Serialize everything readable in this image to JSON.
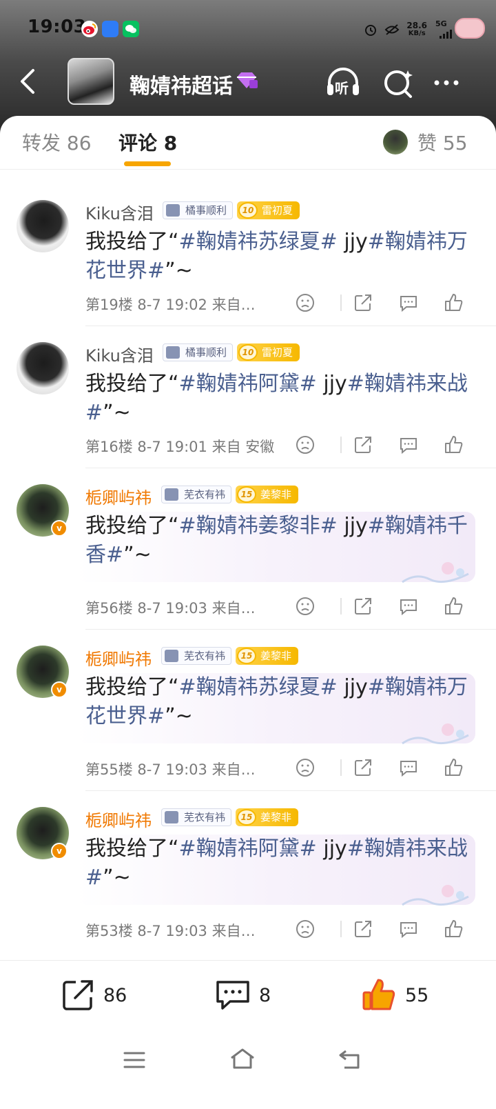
{
  "status_bar": {
    "time": "19:03",
    "net_speed_value": "28.6",
    "net_speed_unit": "KB/s",
    "signal": "5G"
  },
  "header": {
    "title": "鞠婧祎超话",
    "listen_label": "听"
  },
  "tabs": {
    "repost": "转发 86",
    "comment": "评论 8",
    "like": "赞 55"
  },
  "comments": [
    {
      "user": "Kiku含泪",
      "tag": "橘事顺利",
      "level": "10",
      "fan_tag": "雷初夏",
      "text_prefix": "我投给了“",
      "topic1": "#鞠婧祎苏绿夏#",
      "mid": " jjy",
      "topic2": "#鞠婧祎万花世界#",
      "suffix": "”~",
      "meta": "第19楼 8-7 19:02 来自…"
    },
    {
      "user": "Kiku含泪",
      "tag": "橘事顺利",
      "level": "10",
      "fan_tag": "雷初夏",
      "text_prefix": "我投给了“",
      "topic1": "#鞠婧祎阿黛#",
      "mid": " jjy",
      "topic2": "#鞠婧祎来战#",
      "suffix": "”~",
      "meta": "第16楼 8-7 19:01 来自 安徽"
    },
    {
      "user": "栀卿屿祎",
      "tag": "芜衣有祎",
      "level": "15",
      "fan_tag": "姜黎非",
      "text_prefix": "我投给了“",
      "topic1": "#鞠婧祎姜黎非#",
      "mid": " jjy",
      "topic2": "#鞠婧祎千香#",
      "suffix": "”~",
      "meta": "第56楼 8-7 19:03 来自…"
    },
    {
      "user": "栀卿屿祎",
      "tag": "芜衣有祎",
      "level": "15",
      "fan_tag": "姜黎非",
      "text_prefix": "我投给了“",
      "topic1": "#鞠婧祎苏绿夏#",
      "mid": " jjy",
      "topic2": "#鞠婧祎万花世界#",
      "suffix": "”~",
      "meta": "第55楼 8-7 19:03 来自…"
    },
    {
      "user": "栀卿屿祎",
      "tag": "芜衣有祎",
      "level": "15",
      "fan_tag": "姜黎非",
      "text_prefix": "我投给了“",
      "topic1": "#鞠婧祎阿黛#",
      "mid": " jjy",
      "topic2": "#鞠婧祎来战#",
      "suffix": "”~",
      "meta": "第53楼 8-7 19:03 来自…"
    }
  ],
  "bottom_bar": {
    "repost_count": "86",
    "comment_count": "8",
    "like_count": "55"
  },
  "colors": {
    "accent_orange": "#f7a500",
    "topic_blue": "#4a5f8f",
    "vip_name_orange": "#f07800"
  }
}
